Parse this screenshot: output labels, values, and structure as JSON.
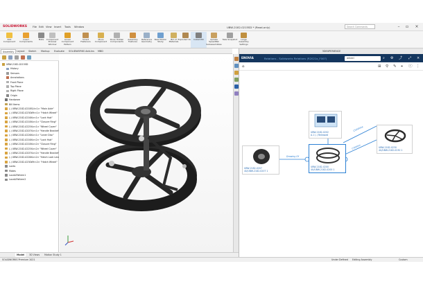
{
  "app": {
    "logo": "SOLIDWORKS",
    "title": "UBW-2182-0215SD * (Read-only)",
    "search_placeholder": "Search Commands",
    "menus": [
      "File",
      "Edit",
      "View",
      "Insert",
      "Tools",
      "Window"
    ]
  },
  "ribbon": [
    "Edit Component",
    "Insert Components",
    "Mate",
    "Component Preview Window",
    "Linear Component Pattern",
    "Smart Fasteners",
    "Move Component",
    "Show Hidden Components",
    "Assembly Features",
    "Reference Geometry",
    "New Motion Study",
    "Bill of Materials",
    "Exploded View",
    "Instant3D",
    "Update SpeedPak Subassemblies",
    "Take Snapshot",
    "Large Assembly Settings"
  ],
  "cmd_tabs": [
    "Assembly",
    "Layout",
    "Sketch",
    "Markup",
    "Evaluate",
    "SOLIDWORKS Add-Ins",
    "MBD"
  ],
  "tree": [
    "UBW-2182-0215SD",
    "History",
    "Sensors",
    "Annotations",
    "Front Plane",
    "Top Plane",
    "Right Plane",
    "Origin",
    "Hardware",
    "Bill Items",
    "(-) UBW-2182-0218SLt<1> \"Main Axle\"",
    "(-) UBW-2182-0230Wh<1> \"Hatch Wheel\"",
    "(-) UBW-2182-0216Xx<1> \"Lock Hub\"",
    "(-) UBW-2182-0218Xx<1> \"Closure Ring\"",
    "(-) UBW-2182-0225Xx<1> \"Wheel Cover\"",
    "(-) UBW-2182-0207Xx<1> \"Handle Bracket\"",
    "(-) UBW-2182-0226Xx<1> \"Lever Disc\"",
    "(-) UBW-2182-0216Xx<2> \"Lock Hub\"",
    "(-) UBW-2182-0218Xx<2> \"Closure Ring\"",
    "(-) UBW-2182-0225Xx<2> \"Wheel Cover\"",
    "(-) UBW-2182-0207Xx<2> \"Handle Bracket\"",
    "(-) UBW-2182-0226Xx<2> \"Hatch Lock Lever\"",
    "(-) UBW-2182-0230Wh<2> \"Hatch Wheel\"",
    "Locks",
    "Mates",
    "LocalLPattern1",
    "LocalLPattern2"
  ],
  "bottom_tabs": [
    "Model",
    "3D Views",
    "Motion Study 1"
  ],
  "status": {
    "left": "SOLIDWORKS Premium 2021",
    "mid1": "Under Defined",
    "mid2": "Editing Assembly",
    "right": "Custom"
  },
  "panel_header": "3DEXPERIENCE",
  "tp": {
    "logo": "ENOVIA",
    "breadcrumb": "Relations - Solidworks Relations (R2021x_F007)",
    "search": "wheel"
  },
  "graph": {
    "nodes": [
      {
        "l1": "UBW-2182-0202",
        "l2": "A.1 (-) Released"
      },
      {
        "l1": "UBW-2182-0207",
        "l2": "4U/UBW-2182-0207 1"
      },
      {
        "l1": "UBW-2182-0200",
        "l2": "4U/UBW-2182-0200 1"
      },
      {
        "l1": "UBW-2182-0230",
        "l2": "4U/UBW-2182-0230 1"
      }
    ],
    "edges": [
      "Drawing Of",
      "Child/Usa",
      "Children"
    ]
  },
  "colors": {
    "brand": "#c8102e",
    "tp_bar": "#14365e",
    "selection": "#2a7fd4"
  }
}
